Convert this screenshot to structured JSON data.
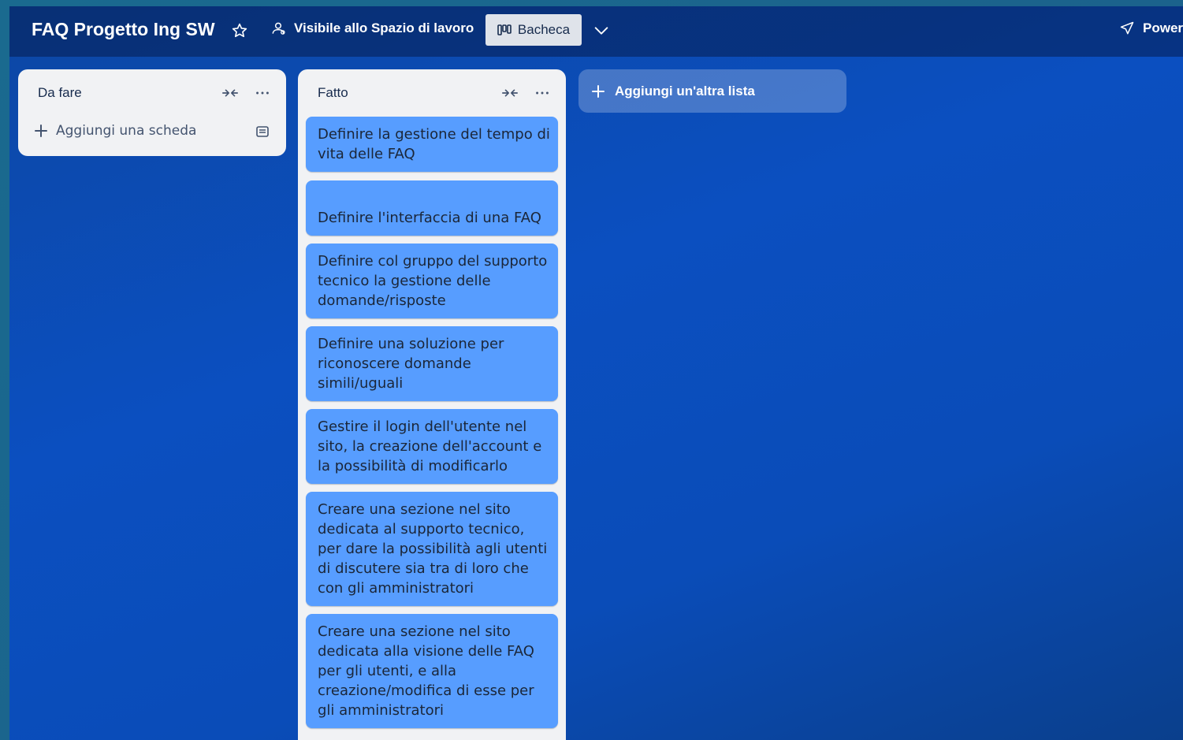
{
  "header": {
    "board_title": "FAQ Progetto Ing SW",
    "visibility_label": "Visibile allo Spazio di lavoro",
    "view_label": "Bacheca",
    "power_ups_label": "Power"
  },
  "lists": [
    {
      "title": "Da fare",
      "add_card_label": "Aggiungi una scheda",
      "cards": []
    },
    {
      "title": "Fatto",
      "cards": [
        {
          "text": "Definire la gestione del tempo di vita delle FAQ"
        },
        {
          "text": "Definire l'interfaccia di una FAQ"
        },
        {
          "text": "Definire col gruppo del supporto tecnico la gestione delle domande/risposte"
        },
        {
          "text": "Definire una soluzione per riconoscere domande simili/uguali"
        },
        {
          "text": "Gestire il login dell'utente nel sito, la creazione dell'account e la possibilità di modificarlo"
        },
        {
          "text": "Creare una sezione nel sito dedicata al supporto tecnico, per dare la possibilità agli utenti di discutere sia tra di loro che con gli amministratori"
        },
        {
          "text": "Creare una sezione nel sito dedicata alla visione delle FAQ per gli utenti, e alla creazione/modifica di esse per gli amministratori"
        }
      ]
    }
  ],
  "add_list_label": "Aggiungi un'altra lista",
  "icons": {
    "star": "star-icon",
    "visibility": "people-icon",
    "view": "board-icon",
    "menu": "chevron-down-icon",
    "power": "rocket-icon",
    "collapse": "collapse-icon",
    "more": "more-icon",
    "add": "plus-icon",
    "template": "template-icon"
  },
  "colors": {
    "card": "#579dff",
    "list": "#f1f2f4",
    "board_bg": "#0b4fc0"
  }
}
